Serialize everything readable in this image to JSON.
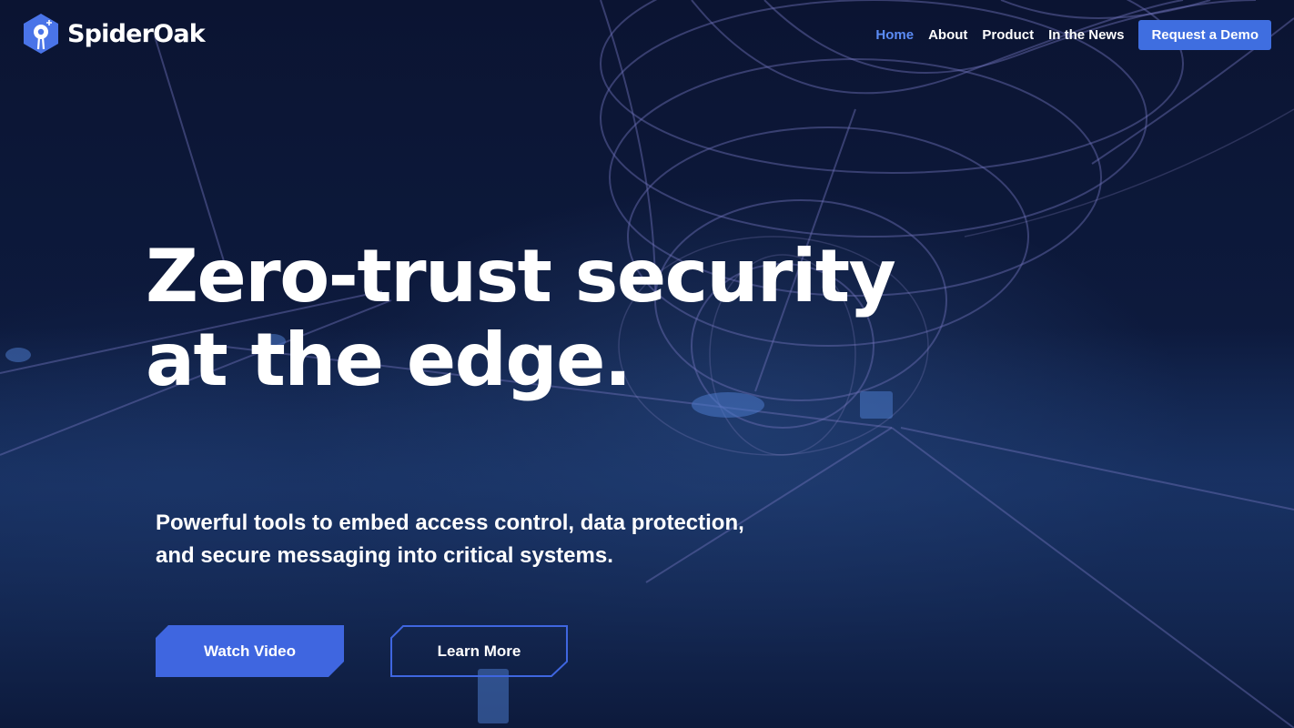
{
  "header": {
    "logo_text": "SpiderOak",
    "nav": [
      {
        "label": "Home",
        "active": true
      },
      {
        "label": "About"
      },
      {
        "label": "Product"
      },
      {
        "label": "In the News"
      }
    ],
    "cta_label": "Request a Demo"
  },
  "hero": {
    "title_lines": [
      "Zero-trust security",
      "at the edge."
    ],
    "subtitle_lines": [
      "Powerful tools to embed access control, data protection,",
      "and secure messaging into critical systems."
    ],
    "primary_button": "Watch Video",
    "secondary_button": "Learn More"
  },
  "colors": {
    "accent": "#3f66e0",
    "active_nav": "#5b8cf6",
    "background": "#0b1432"
  }
}
